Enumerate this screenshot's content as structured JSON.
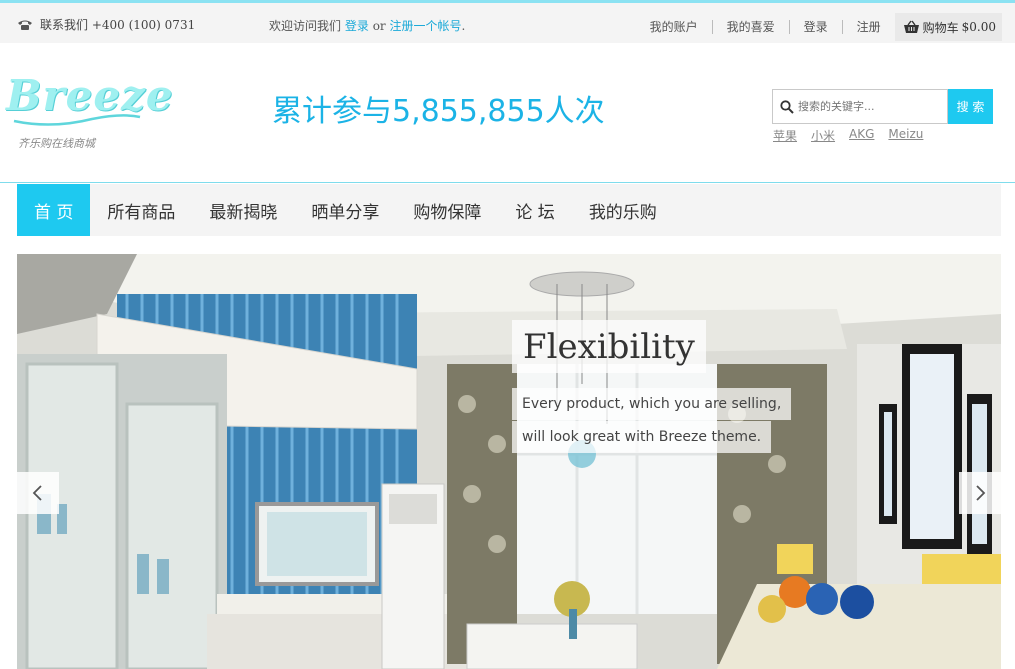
{
  "topbar": {
    "contact_label": "联系我们 +400 (100) 0731",
    "welcome_prefix": "欢迎访问我们",
    "login_link": "登录",
    "or_text": "or",
    "register_link": "注册一个帐号",
    "period": ".",
    "links": [
      "我的账户",
      "我的喜爱",
      "登录",
      "注册"
    ],
    "cart_label": "购物车",
    "cart_total": "$0.00"
  },
  "header": {
    "logo_text": "Breeze",
    "slogan": "齐乐购在线商城",
    "counter_text": "累计参与5,855,855人次",
    "search_placeholder": "搜索的关键字...",
    "search_button": "搜 索",
    "hot_keywords": [
      "苹果",
      "小米",
      "AKG",
      "Meizu"
    ]
  },
  "nav": {
    "items": [
      "首 页",
      "所有商品",
      "最新揭晓",
      "晒单分享",
      "购物保障",
      "论 坛",
      "我的乐购"
    ],
    "active_index": 0
  },
  "slider": {
    "title": "Flexibility",
    "line1": "Every product, which you are selling,",
    "line2": "will look great with Breeze theme."
  },
  "colors": {
    "accent": "#1ec9f0",
    "link": "#1aa9d8",
    "counter": "#1bb3e6",
    "topbar_border": "#8be2f2"
  },
  "icons": {
    "phone": "phone-icon",
    "cart": "cart-icon",
    "search": "search-icon",
    "prev": "chevron-left-icon",
    "next": "chevron-right-icon"
  }
}
